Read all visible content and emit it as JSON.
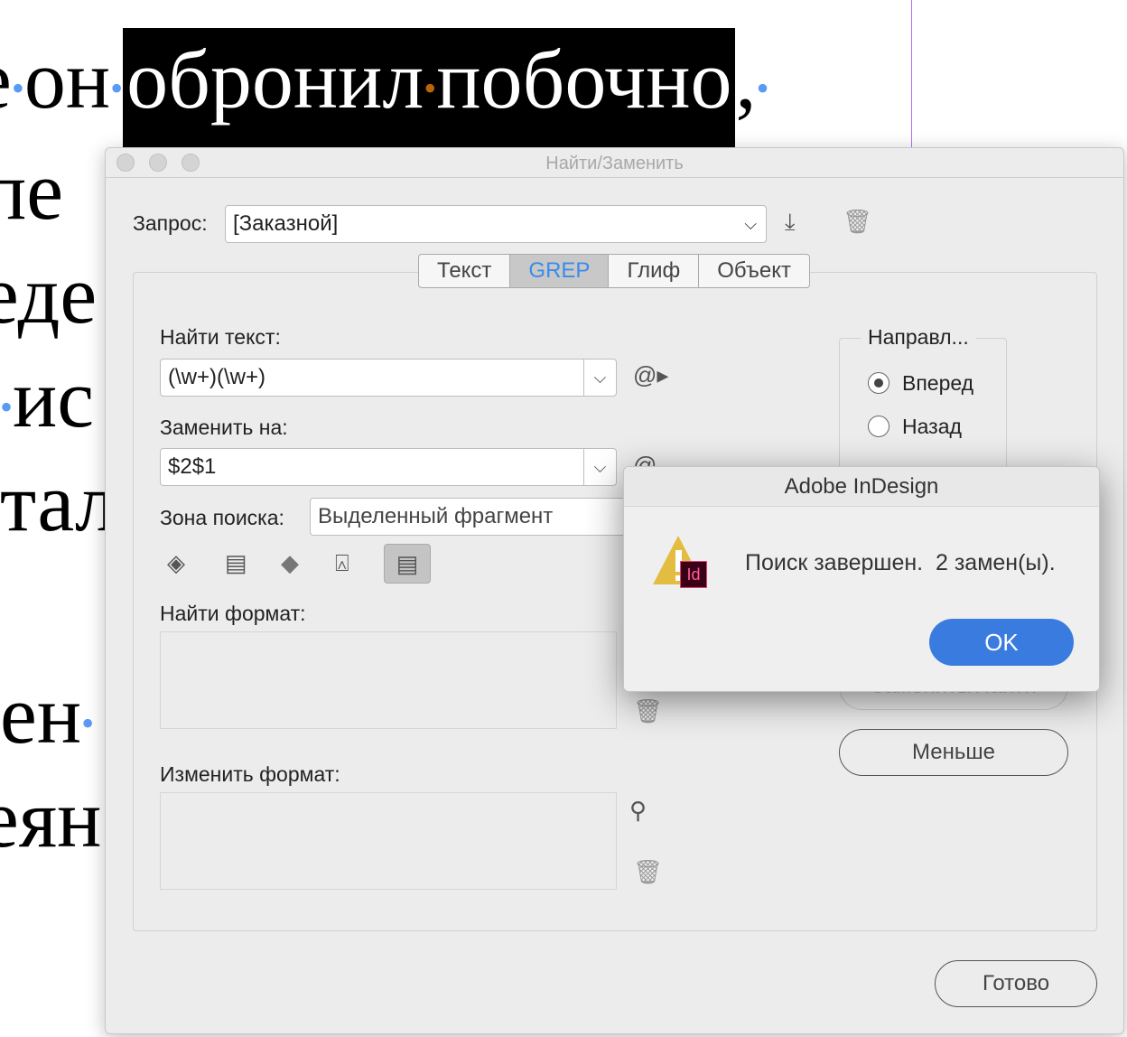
{
  "document": {
    "line1_before": "е",
    "line1_on": "он",
    "line1_sel1": "обронил",
    "line1_sel2": "побочно",
    "line1_after": ",",
    "fragments": [
      "пе",
      "еде",
      "ис",
      "тал",
      "ен",
      "еян"
    ]
  },
  "dialog": {
    "title": "Найти/Заменить",
    "query_label": "Запрос:",
    "query_value": "[Заказной]",
    "tabs": [
      {
        "label": "Текст"
      },
      {
        "label": "GREP"
      },
      {
        "label": "Глиф"
      },
      {
        "label": "Объект"
      }
    ],
    "find_label": "Найти текст:",
    "find_value": "(\\w+)(\\w+)",
    "replace_label": "Заменить на:",
    "replace_value": "$2$1",
    "scope_label": "Зона поиска:",
    "scope_value": "Выделенный фрагмент",
    "direction_label": "Направл...",
    "forward_label": "Вперед",
    "back_label": "Назад",
    "find_format_label": "Найти формат:",
    "change_format_label": "Изменить формат:",
    "replace_find_button": "Заменить/Найти",
    "less_button": "Меньше",
    "done_button": "Готово",
    "at_symbol": "@"
  },
  "alert": {
    "title": "Adobe InDesign",
    "message": "Поиск завершен.  2 замен(ы).",
    "ok_button": "OK",
    "app_badge": "Id"
  },
  "colors": {
    "accent": "#3a7be0",
    "tab_active": "#3b8beb"
  }
}
